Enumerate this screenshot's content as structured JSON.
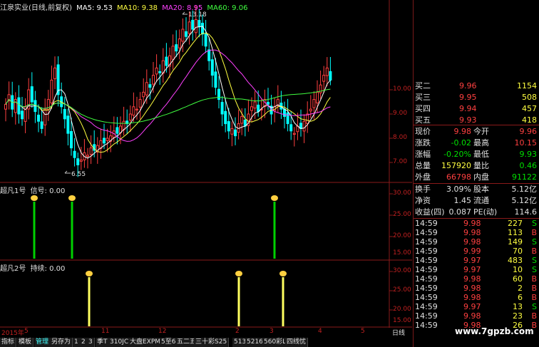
{
  "main": {
    "title": "江泉实业(日线,前复权)",
    "ma5": "MA5: 9.53",
    "ma10": "MA10: 9.38",
    "ma20": "MA20: 8.95",
    "ma60": "MA60: 9.06",
    "high_label": "13.18",
    "low_label": "6.55",
    "yticks": [
      "10.00",
      "9.00",
      "8.00",
      "7.00"
    ]
  },
  "ind1": {
    "title": "超凡1号",
    "label": "信号: 0.00",
    "yticks": [
      "30.00",
      "25.00",
      "20.00",
      "15.00",
      "10.00"
    ]
  },
  "ind2": {
    "title": "超凡2号",
    "label": "持续: 0.00",
    "yticks": [
      "30.00",
      "25.00",
      "20.00",
      "15.00",
      "10.00"
    ]
  },
  "dates": [
    "2015年",
    "5",
    "11",
    "12",
    "2",
    "3",
    "4",
    "5",
    "日线"
  ],
  "tabs": [
    "指标",
    "模板",
    "管理",
    "另存为",
    "1",
    "2",
    "3",
    "季T",
    "310JC",
    "大盘EXPMA",
    "5至60",
    "五二五",
    "三十彩S25",
    "513",
    "52160",
    "560彩L",
    "四线忧"
  ],
  "colors": {
    "up": "#ff4040",
    "down": "#00ffff",
    "accent": "#c02020",
    "green": "#00e000",
    "yellow": "#ffff40"
  },
  "quote": {
    "bids": [
      {
        "name": "买二",
        "price": "9.96",
        "vol": "1154"
      },
      {
        "name": "买三",
        "price": "9.95",
        "vol": "508"
      },
      {
        "name": "买四",
        "price": "9.94",
        "vol": "457"
      },
      {
        "name": "买五",
        "price": "9.93",
        "vol": "418"
      }
    ],
    "stats": [
      {
        "l1": "现价",
        "v1": "9.98",
        "l2": "今开",
        "v2": "9.96"
      },
      {
        "l1": "涨跌",
        "v1": "-0.02",
        "l2": "最高",
        "v2": "10.15"
      },
      {
        "l1": "涨幅",
        "v1": "-0.20%",
        "l2": "最低",
        "v2": "9.93"
      },
      {
        "l1": "总量",
        "v1": "157920",
        "l2": "量比",
        "v2": "0.46"
      },
      {
        "l1": "外盘",
        "v1": "66798",
        "l2": "内盘",
        "v2": "91122"
      }
    ],
    "fin": [
      {
        "l1": "换手",
        "v1": "3.09%",
        "l2": "股本",
        "v2": "5.12亿"
      },
      {
        "l1": "净资",
        "v1": "1.45",
        "l2": "流通",
        "v2": "5.12亿"
      },
      {
        "l1": "收益(四)",
        "v1": "0.087",
        "l2": "PE(动)",
        "v2": "114.6"
      }
    ],
    "ticks": [
      {
        "t": "14:59",
        "p": "9.98",
        "v": "227",
        "s": "S"
      },
      {
        "t": "14:59",
        "p": "9.98",
        "v": "113",
        "s": "B"
      },
      {
        "t": "14:59",
        "p": "9.98",
        "v": "149",
        "s": "S"
      },
      {
        "t": "14:59",
        "p": "9.99",
        "v": "70",
        "s": "B"
      },
      {
        "t": "14:59",
        "p": "9.97",
        "v": "483",
        "s": "S"
      },
      {
        "t": "14:59",
        "p": "9.97",
        "v": "10",
        "s": "S"
      },
      {
        "t": "14:59",
        "p": "9.98",
        "v": "60",
        "s": "B"
      },
      {
        "t": "14:59",
        "p": "9.98",
        "v": "2",
        "s": "B"
      },
      {
        "t": "14:59",
        "p": "9.98",
        "v": "6",
        "s": "B"
      },
      {
        "t": "14:59",
        "p": "9.97",
        "v": "13",
        "s": "S"
      },
      {
        "t": "14:59",
        "p": "9.98",
        "v": "23",
        "s": "B"
      },
      {
        "t": "14:59",
        "p": "9.98",
        "v": "26",
        "s": "B"
      }
    ],
    "watermark": "www.7gpzb.com"
  }
}
